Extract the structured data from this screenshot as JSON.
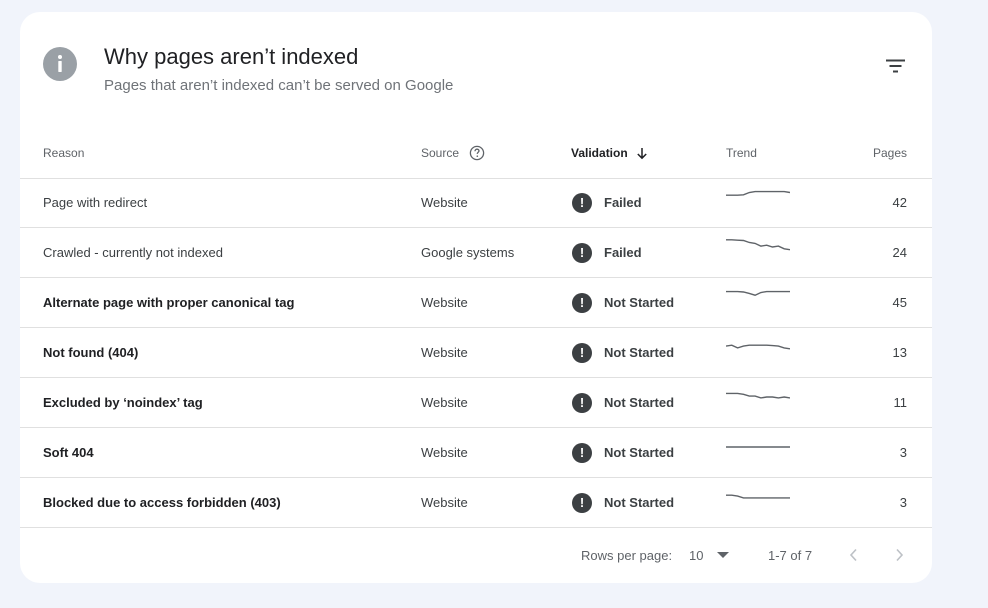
{
  "header": {
    "title": "Why pages aren’t indexed",
    "subtitle": "Pages that aren’t indexed can’t be served on Google",
    "info_icon": "info-icon",
    "filter_icon": "filter-icon"
  },
  "columns": {
    "reason": "Reason",
    "source": "Source",
    "validation": "Validation",
    "trend": "Trend",
    "pages": "Pages"
  },
  "rows": [
    {
      "reason": "Page with redirect",
      "bold": false,
      "source": "Website",
      "validation": "Failed",
      "trend": [
        0.6,
        0.6,
        0.6,
        0.62,
        0.75,
        0.8,
        0.8,
        0.8,
        0.8,
        0.8,
        0.8,
        0.75
      ],
      "pages": "42"
    },
    {
      "reason": "Crawled - currently not indexed",
      "bold": false,
      "source": "Google systems",
      "validation": "Failed",
      "trend": [
        0.9,
        0.9,
        0.88,
        0.86,
        0.75,
        0.7,
        0.55,
        0.6,
        0.5,
        0.55,
        0.4,
        0.35
      ],
      "pages": "24"
    },
    {
      "reason": "Alternate page with proper canonical tag",
      "bold": true,
      "source": "Website",
      "validation": "Not Started",
      "trend": [
        0.8,
        0.8,
        0.8,
        0.78,
        0.7,
        0.6,
        0.75,
        0.8,
        0.8,
        0.8,
        0.8,
        0.8
      ],
      "pages": "45"
    },
    {
      "reason": "Not found (404)",
      "bold": true,
      "source": "Website",
      "validation": "Not Started",
      "trend": [
        0.55,
        0.6,
        0.45,
        0.55,
        0.6,
        0.6,
        0.6,
        0.6,
        0.58,
        0.55,
        0.45,
        0.4
      ],
      "pages": "13"
    },
    {
      "reason": "Excluded by ‘noindex’ tag",
      "bold": true,
      "source": "Website",
      "validation": "Not Started",
      "trend": [
        0.7,
        0.7,
        0.7,
        0.65,
        0.55,
        0.55,
        0.45,
        0.5,
        0.5,
        0.45,
        0.5,
        0.45
      ],
      "pages": "11"
    },
    {
      "reason": "Soft 404",
      "bold": true,
      "source": "Website",
      "validation": "Not Started",
      "trend": [
        0.5,
        0.5,
        0.5,
        0.5,
        0.5,
        0.5,
        0.5,
        0.5,
        0.5,
        0.5,
        0.5,
        0.5
      ],
      "pages": "3"
    },
    {
      "reason": "Blocked due to access forbidden (403)",
      "bold": true,
      "source": "Website",
      "validation": "Not Started",
      "trend": [
        0.6,
        0.6,
        0.55,
        0.45,
        0.45,
        0.45,
        0.45,
        0.45,
        0.45,
        0.45,
        0.45,
        0.45
      ],
      "pages": "3"
    }
  ],
  "footer": {
    "rows_per_page_label": "Rows per page:",
    "rows_per_page_value": "10",
    "range": "1-7 of 7"
  }
}
